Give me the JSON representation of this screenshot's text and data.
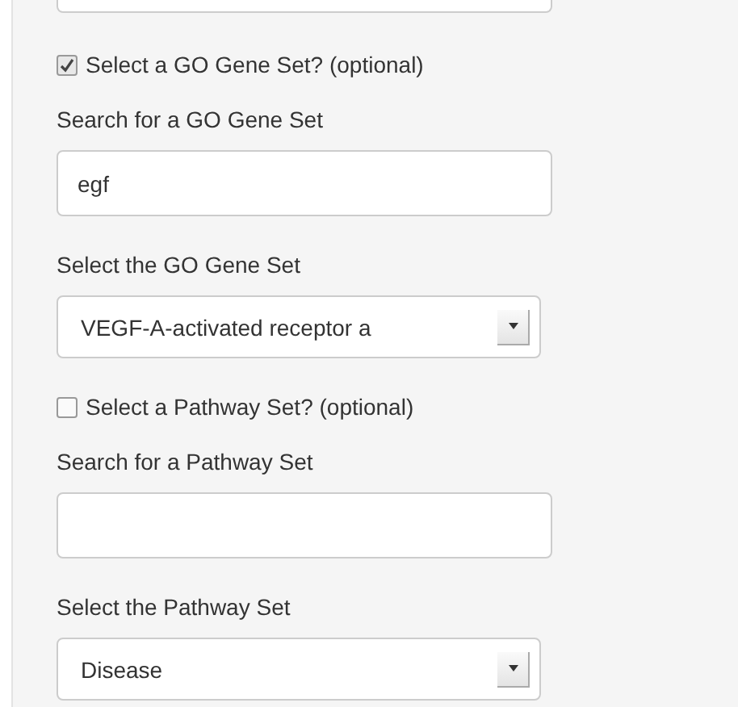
{
  "go_section": {
    "checkbox": {
      "label": "Select a GO Gene Set? (optional)",
      "checked": true
    },
    "search": {
      "label": "Search for a GO Gene Set",
      "value": "egf"
    },
    "select": {
      "label": "Select the GO Gene Set",
      "value": "VEGF-A-activated receptor a"
    }
  },
  "pathway_section": {
    "checkbox": {
      "label": "Select a Pathway Set? (optional)",
      "checked": false
    },
    "search": {
      "label": "Search for a Pathway Set"
    },
    "select": {
      "label": "Select the Pathway Set",
      "value": "Disease"
    }
  }
}
